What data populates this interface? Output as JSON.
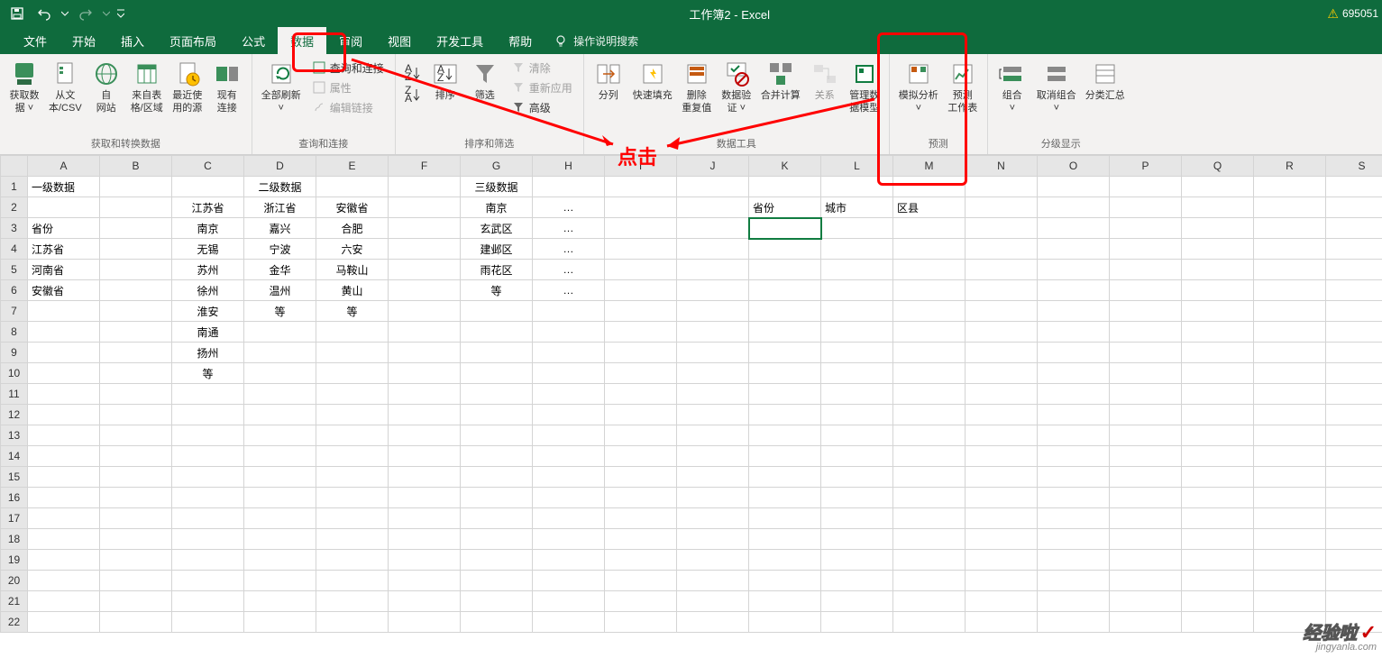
{
  "title": "工作簿2 - Excel",
  "user_badge": "695051",
  "tabs": {
    "file": "文件",
    "home": "开始",
    "insert": "插入",
    "layout": "页面布局",
    "formula": "公式",
    "data": "数据",
    "review": "审阅",
    "view": "视图",
    "dev": "开发工具",
    "help": "帮助"
  },
  "tellme": "操作说明搜索",
  "ribbon": {
    "g1": {
      "label": "获取和转换数据",
      "b1": "获取数\n据 ˅",
      "b2": "从文\n本/CSV",
      "b3": "自\n网站",
      "b4": "来自表\n格/区域",
      "b5": "最近使\n用的源",
      "b6": "现有\n连接"
    },
    "g2": {
      "label": "查询和连接",
      "b1": "全部刷新\n˅",
      "s1": "查询和连接",
      "s2": "属性",
      "s3": "编辑链接"
    },
    "g3": {
      "label": "排序和筛选",
      "b1": "排序",
      "b2": "筛选",
      "s1": "清除",
      "s2": "重新应用",
      "s3": "高级"
    },
    "g4": {
      "label": "数据工具",
      "b1": "分列",
      "b2": "快速填充",
      "b3": "删除\n重复值",
      "b4": "数据验\n证 ˅",
      "b5": "合并计算",
      "b6": "关系",
      "b7": "管理数\n据模型"
    },
    "g5": {
      "label": "预测",
      "b1": "模拟分析\n˅",
      "b2": "预测\n工作表"
    },
    "g6": {
      "label": "分级显示",
      "b1": "组合\n˅",
      "b2": "取消组合\n˅",
      "b3": "分类汇总"
    }
  },
  "annot": "点击",
  "cols": [
    "A",
    "B",
    "C",
    "D",
    "E",
    "F",
    "G",
    "H",
    "I",
    "J",
    "K",
    "L",
    "M",
    "N",
    "O",
    "P",
    "Q",
    "R",
    "S"
  ],
  "cells": {
    "r1": {
      "A": "一级数据",
      "D": "二级数据",
      "G": "三级数据"
    },
    "r2": {
      "C": "江苏省",
      "D": "浙江省",
      "E": "安徽省",
      "G": "南京",
      "H": "…",
      "K": "省份",
      "L": "城市",
      "M": "区县"
    },
    "r3": {
      "A": "省份",
      "C": "南京",
      "D": "嘉兴",
      "E": "合肥",
      "G": "玄武区",
      "H": "…"
    },
    "r4": {
      "A": "江苏省",
      "C": "无锡",
      "D": "宁波",
      "E": "六安",
      "G": "建邺区",
      "H": "…"
    },
    "r5": {
      "A": "河南省",
      "C": "苏州",
      "D": "金华",
      "E": "马鞍山",
      "G": "雨花区",
      "H": "…"
    },
    "r6": {
      "A": "安徽省",
      "C": "徐州",
      "D": "温州",
      "E": "黄山",
      "G": "等",
      "H": "…"
    },
    "r7": {
      "C": "淮安",
      "D": "等",
      "E": "等"
    },
    "r8": {
      "C": "南通"
    },
    "r9": {
      "C": "扬州"
    },
    "r10": {
      "C": "等"
    }
  },
  "wm": {
    "l1": "经验啦",
    "l2": "jingyanla.com"
  }
}
